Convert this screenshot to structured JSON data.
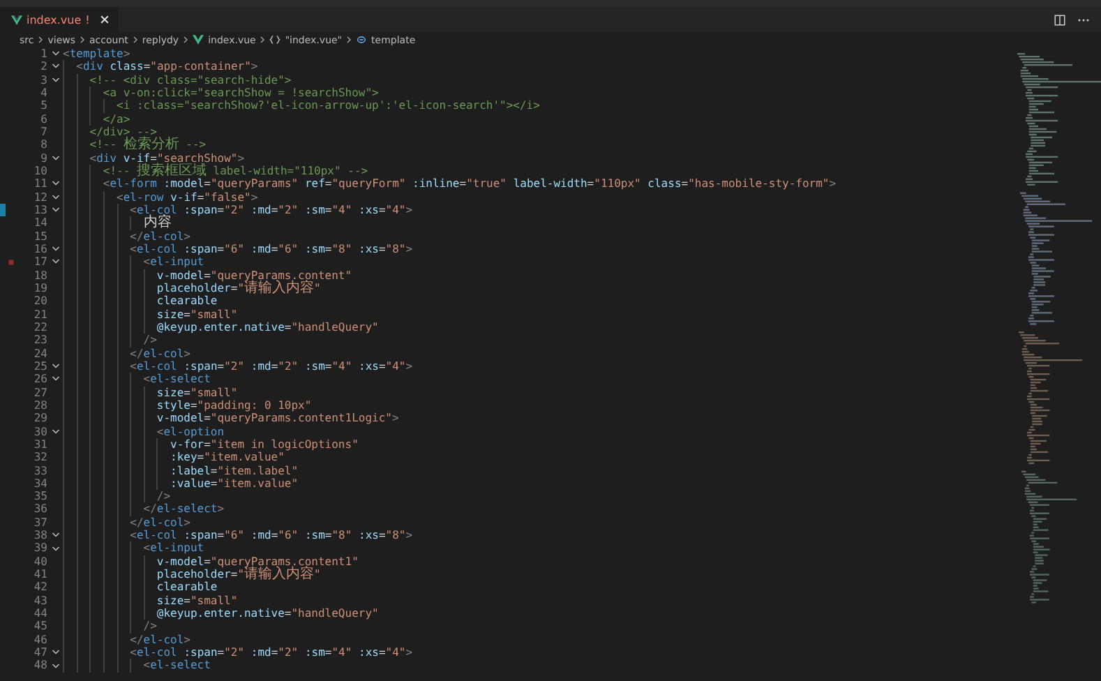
{
  "tab": {
    "label": "index.vue",
    "badge": "!",
    "selected": true
  },
  "breadcrumb": [
    {
      "kind": "folder",
      "label": "src"
    },
    {
      "kind": "folder",
      "label": "views"
    },
    {
      "kind": "folder",
      "label": "account"
    },
    {
      "kind": "folder",
      "label": "replydy"
    },
    {
      "kind": "file",
      "label": "index.vue"
    },
    {
      "kind": "object",
      "label": "\"index.vue\""
    },
    {
      "kind": "element",
      "label": "template"
    }
  ],
  "code_lines": [
    {
      "number": "1",
      "text": "<template>",
      "fold": true,
      "breakpoint": false,
      "changed": false
    },
    {
      "number": "2",
      "text": "  <div class=\"app-container\">",
      "fold": true,
      "breakpoint": false,
      "changed": false
    },
    {
      "number": "3",
      "text": "    <!-- <div class=\"search-hide\">",
      "fold": true,
      "breakpoint": false,
      "changed": false
    },
    {
      "number": "4",
      "text": "      <a v-on:click=\"searchShow = !searchShow\">",
      "fold": false,
      "breakpoint": false,
      "changed": false
    },
    {
      "number": "5",
      "text": "        <i :class=\"searchShow?'el-icon-arrow-up':'el-icon-search'\"></i>",
      "fold": false,
      "breakpoint": false,
      "changed": false
    },
    {
      "number": "6",
      "text": "      </a>",
      "fold": false,
      "breakpoint": false,
      "changed": false
    },
    {
      "number": "7",
      "text": "    </div> -->",
      "fold": false,
      "breakpoint": false,
      "changed": false
    },
    {
      "number": "8",
      "text": "    <!-- 检索分析 -->",
      "fold": false,
      "breakpoint": false,
      "changed": false
    },
    {
      "number": "9",
      "text": "    <div v-if=\"searchShow\">",
      "fold": true,
      "breakpoint": false,
      "changed": false
    },
    {
      "number": "10",
      "text": "      <!-- 搜索框区域 label-width=\"110px\" -->",
      "fold": false,
      "breakpoint": false,
      "changed": false
    },
    {
      "number": "11",
      "text": "      <el-form :model=\"queryParams\" ref=\"queryForm\" :inline=\"true\" label-width=\"110px\" class=\"has-mobile-sty-form\">",
      "fold": true,
      "breakpoint": false,
      "changed": false
    },
    {
      "number": "12",
      "text": "        <el-row v-if=\"false\">",
      "fold": true,
      "breakpoint": false,
      "changed": false
    },
    {
      "number": "13",
      "text": "          <el-col :span=\"2\" :md=\"2\" :sm=\"4\" :xs=\"4\">",
      "fold": true,
      "breakpoint": false,
      "changed": true
    },
    {
      "number": "14",
      "text": "            内容",
      "fold": false,
      "breakpoint": false,
      "changed": false
    },
    {
      "number": "15",
      "text": "          </el-col>",
      "fold": false,
      "breakpoint": false,
      "changed": false
    },
    {
      "number": "16",
      "text": "          <el-col :span=\"6\" :md=\"6\" :sm=\"8\" :xs=\"8\">",
      "fold": true,
      "breakpoint": false,
      "changed": false
    },
    {
      "number": "17",
      "text": "            <el-input",
      "fold": true,
      "breakpoint": true,
      "changed": false
    },
    {
      "number": "18",
      "text": "              v-model=\"queryParams.content\"",
      "fold": false,
      "breakpoint": false,
      "changed": false
    },
    {
      "number": "19",
      "text": "              placeholder=\"请输入内容\"",
      "fold": false,
      "breakpoint": false,
      "changed": false
    },
    {
      "number": "20",
      "text": "              clearable",
      "fold": false,
      "breakpoint": false,
      "changed": false
    },
    {
      "number": "21",
      "text": "              size=\"small\"",
      "fold": false,
      "breakpoint": false,
      "changed": false
    },
    {
      "number": "22",
      "text": "              @keyup.enter.native=\"handleQuery\"",
      "fold": false,
      "breakpoint": false,
      "changed": false
    },
    {
      "number": "23",
      "text": "            />",
      "fold": false,
      "breakpoint": false,
      "changed": false
    },
    {
      "number": "24",
      "text": "          </el-col>",
      "fold": false,
      "breakpoint": false,
      "changed": false
    },
    {
      "number": "25",
      "text": "          <el-col :span=\"2\" :md=\"2\" :sm=\"4\" :xs=\"4\">",
      "fold": true,
      "breakpoint": false,
      "changed": false
    },
    {
      "number": "26",
      "text": "            <el-select",
      "fold": true,
      "breakpoint": false,
      "changed": false
    },
    {
      "number": "27",
      "text": "              size=\"small\"",
      "fold": false,
      "breakpoint": false,
      "changed": false
    },
    {
      "number": "28",
      "text": "              style=\"padding: 0 10px\"",
      "fold": false,
      "breakpoint": false,
      "changed": false
    },
    {
      "number": "29",
      "text": "              v-model=\"queryParams.content1Logic\">",
      "fold": false,
      "breakpoint": false,
      "changed": false
    },
    {
      "number": "30",
      "text": "              <el-option",
      "fold": true,
      "breakpoint": false,
      "changed": false
    },
    {
      "number": "31",
      "text": "                v-for=\"item in logicOptions\"",
      "fold": false,
      "breakpoint": false,
      "changed": false
    },
    {
      "number": "32",
      "text": "                :key=\"item.value\"",
      "fold": false,
      "breakpoint": false,
      "changed": false
    },
    {
      "number": "33",
      "text": "                :label=\"item.label\"",
      "fold": false,
      "breakpoint": false,
      "changed": false
    },
    {
      "number": "34",
      "text": "                :value=\"item.value\"",
      "fold": false,
      "breakpoint": false,
      "changed": false
    },
    {
      "number": "35",
      "text": "              />",
      "fold": false,
      "breakpoint": false,
      "changed": false
    },
    {
      "number": "36",
      "text": "            </el-select>",
      "fold": false,
      "breakpoint": false,
      "changed": false
    },
    {
      "number": "37",
      "text": "          </el-col>",
      "fold": false,
      "breakpoint": false,
      "changed": false
    },
    {
      "number": "38",
      "text": "          <el-col :span=\"6\" :md=\"6\" :sm=\"8\" :xs=\"8\">",
      "fold": true,
      "breakpoint": false,
      "changed": false
    },
    {
      "number": "39",
      "text": "            <el-input",
      "fold": true,
      "breakpoint": false,
      "changed": false
    },
    {
      "number": "40",
      "text": "              v-model=\"queryParams.content1\"",
      "fold": false,
      "breakpoint": false,
      "changed": false
    },
    {
      "number": "41",
      "text": "              placeholder=\"请输入内容\"",
      "fold": false,
      "breakpoint": false,
      "changed": false
    },
    {
      "number": "42",
      "text": "              clearable",
      "fold": false,
      "breakpoint": false,
      "changed": false
    },
    {
      "number": "43",
      "text": "              size=\"small\"",
      "fold": false,
      "breakpoint": false,
      "changed": false
    },
    {
      "number": "44",
      "text": "              @keyup.enter.native=\"handleQuery\"",
      "fold": false,
      "breakpoint": false,
      "changed": false
    },
    {
      "number": "45",
      "text": "            />",
      "fold": false,
      "breakpoint": false,
      "changed": false
    },
    {
      "number": "46",
      "text": "          </el-col>",
      "fold": false,
      "breakpoint": false,
      "changed": false
    },
    {
      "number": "47",
      "text": "          <el-col :span=\"2\" :md=\"2\" :sm=\"4\" :xs=\"4\">",
      "fold": true,
      "breakpoint": false,
      "changed": false
    },
    {
      "number": "48",
      "text": "            <el-select",
      "fold": true,
      "breakpoint": false,
      "changed": false
    }
  ]
}
